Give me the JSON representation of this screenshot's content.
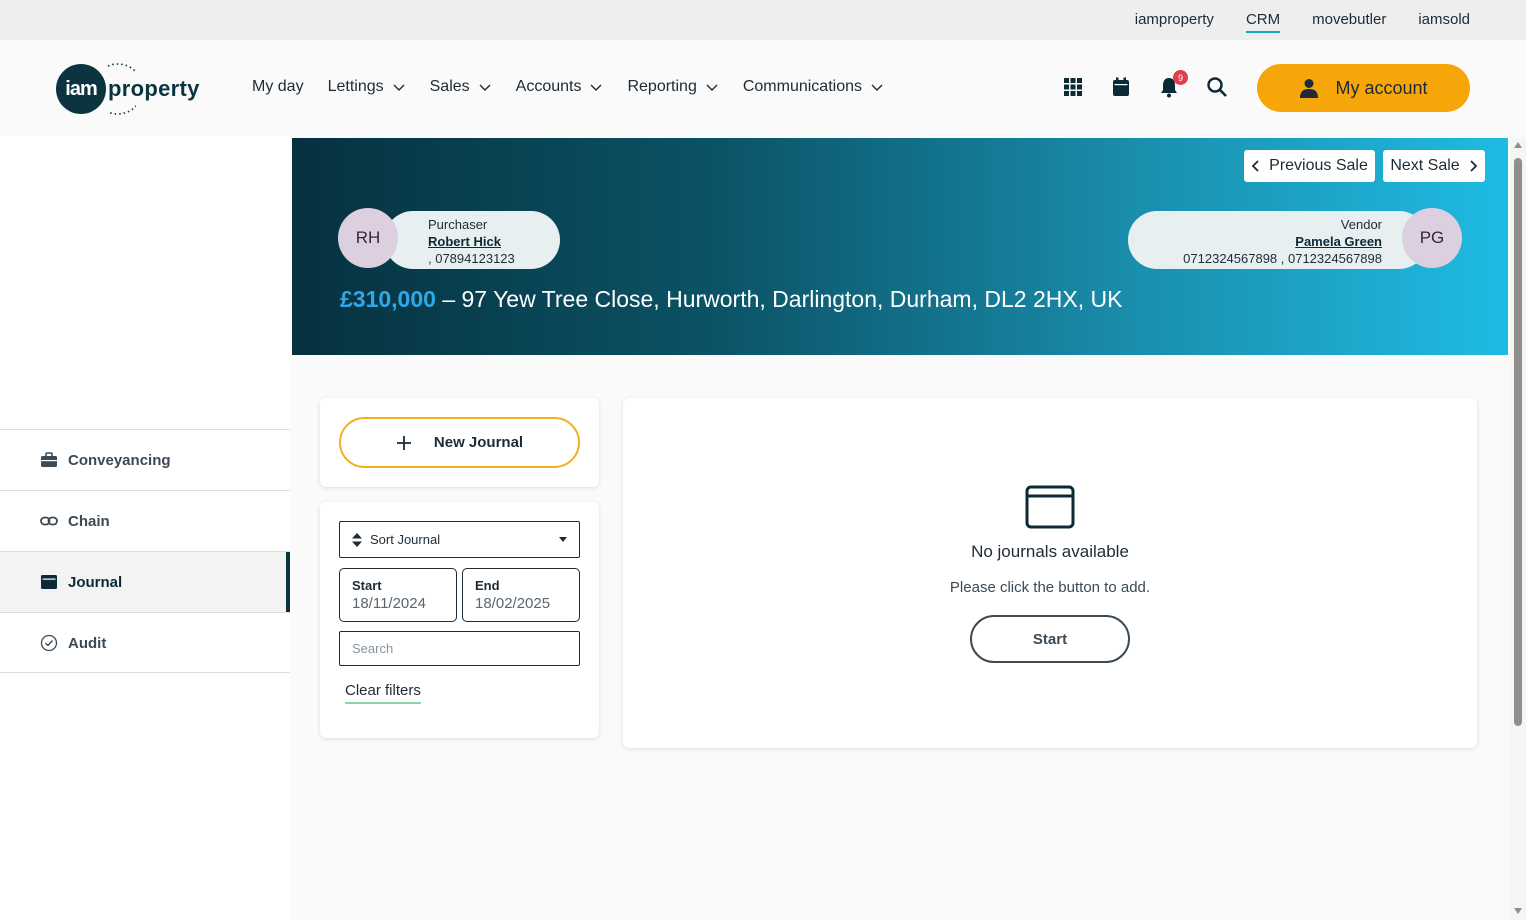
{
  "topbar": {
    "links": [
      "iamproperty",
      "CRM",
      "movebutler",
      "iamsold"
    ],
    "active": "CRM"
  },
  "header": {
    "logo": {
      "mark": "iam",
      "word": "property"
    },
    "nav": [
      "My day",
      "Lettings",
      "Sales",
      "Accounts",
      "Reporting",
      "Communications"
    ],
    "icons": [
      "apps-grid-icon",
      "calendar-icon",
      "bell-icon",
      "search-icon"
    ],
    "notification_count": "9",
    "account_label": "My account"
  },
  "sidebar": {
    "items": [
      {
        "label": "Conveyancing",
        "icon": "briefcase-icon"
      },
      {
        "label": "Chain",
        "icon": "link-icon"
      },
      {
        "label": "Journal",
        "icon": "journal-icon",
        "active": true
      },
      {
        "label": "Audit",
        "icon": "check-circle-icon"
      }
    ]
  },
  "banner": {
    "prev_label": "Previous Sale",
    "next_label": "Next Sale",
    "purchaser": {
      "role": "Purchaser",
      "name": "Robert Hick",
      "phone": ", 07894123123",
      "initials": "RH"
    },
    "vendor": {
      "role": "Vendor",
      "name": "Pamela Green",
      "phone": "0712324567898 , 0712324567898",
      "initials": "PG"
    },
    "price": "£310,000",
    "address": " – 97 Yew Tree Close, Hurworth, Darlington, Durham, DL2 2HX, UK"
  },
  "journal": {
    "new_label": "New Journal",
    "sort_label": "Sort Journal",
    "start_label": "Start",
    "start_value": "18/11/2024",
    "end_label": "End",
    "end_value": "18/02/2025",
    "search_placeholder": "Search",
    "clear_label": "Clear filters",
    "empty_title": "No journals available",
    "empty_sub": "Please click the button to add.",
    "start_button": "Start"
  },
  "colors": {
    "accent": "#f6a609",
    "dark": "#0b3440",
    "price": "#2fa8ea"
  }
}
